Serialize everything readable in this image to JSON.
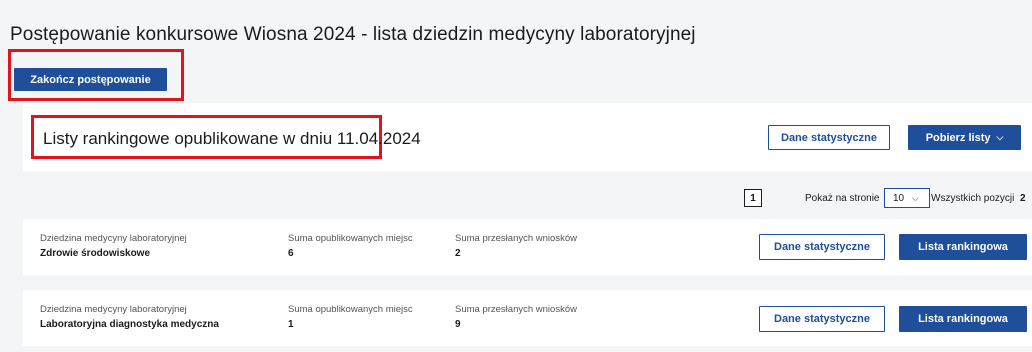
{
  "page_title": "Postępowanie konkursowe Wiosna 2024 - lista dziedzin medycyny laboratoryjnej",
  "finish_button": "Zakończ postępowanie",
  "section": {
    "title": "Listy rankingowe opublikowane w dniu 11.04.2024",
    "stats_button": "Dane statystyczne",
    "download_button": "Pobierz listy"
  },
  "pagination": {
    "current_page": "1",
    "per_page_label": "Pokaż na stronie",
    "per_page_value": "10",
    "total_label": "Wszystkich pozycji",
    "total_value": "2"
  },
  "items": [
    {
      "field_label": "Dziedzina medycyny laboratoryjnej",
      "field_value": "Zdrowie środowiskowe",
      "places_label": "Suma opublikowanych miejsc",
      "places_value": "6",
      "applications_label": "Suma przesłanych wniosków",
      "applications_value": "2",
      "stats_button": "Dane statystyczne",
      "ranking_button": "Lista rankingowa"
    },
    {
      "field_label": "Dziedzina medycyny laboratoryjnej",
      "field_value": "Laboratoryjna diagnostyka medyczna",
      "places_label": "Suma opublikowanych miejsc",
      "places_value": "1",
      "applications_label": "Suma przesłanych wniosków",
      "applications_value": "9",
      "stats_button": "Dane statystyczne",
      "ranking_button": "Lista rankingowa"
    }
  ],
  "colors": {
    "primary": "#1f4e9a",
    "highlight": "#e1141e",
    "background": "#f4f5f6",
    "card": "#ffffff"
  },
  "icons": {
    "dropdown": "chevron-down-icon"
  }
}
